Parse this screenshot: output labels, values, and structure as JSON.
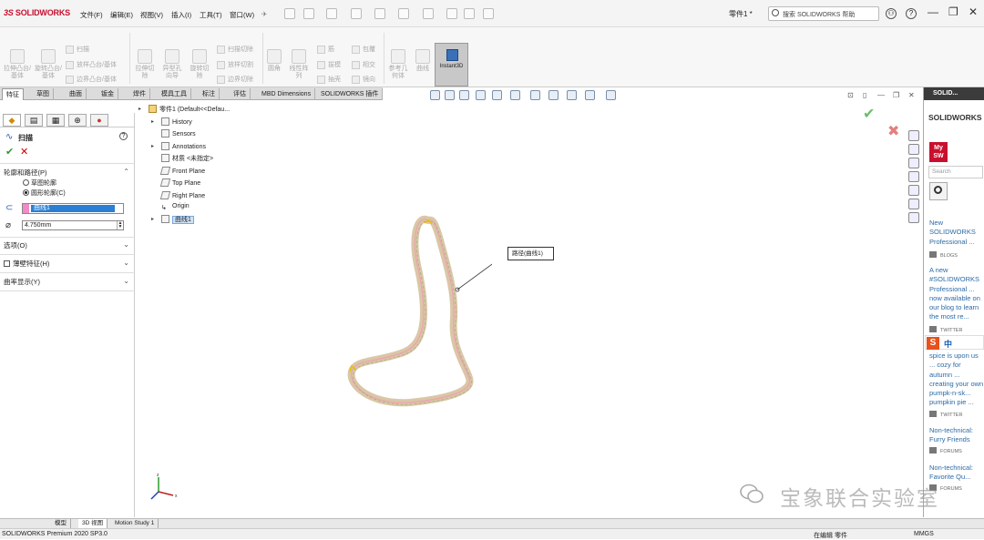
{
  "app": {
    "brand": "SOLIDWORKS",
    "doc_title": "零件1 *"
  },
  "menu": [
    "文件(F)",
    "编辑(E)",
    "视图(V)",
    "插入(I)",
    "工具(T)",
    "窗口(W)"
  ],
  "search": {
    "text": "搜索 SOLIDWORKS 帮助"
  },
  "window_controls": {
    "minimize": "—",
    "restore": "❐",
    "close": "✕"
  },
  "features": {
    "extrude_boss": "拉伸凸台/基体",
    "revolve_boss": "旋转凸台/基体",
    "sweep": "扫描",
    "loft_boss": "放样凸台/基体",
    "boundary_boss": "边界凸台/基体",
    "extrude_cut": "拉伸切除",
    "hole_wizard": "异型孔向导",
    "revolve_cut": "旋转切除",
    "swept_cut": "扫描切除",
    "lofted_cut": "放样切割",
    "boundary_cut": "边界切除",
    "fillet": "圆角",
    "linear_pattern": "线性阵列",
    "rib": "筋",
    "draft": "拔模",
    "shell": "抽壳",
    "wrap": "包覆",
    "intersect": "相交",
    "mirror": "镜向",
    "ref_geometry": "参考几何体",
    "curves": "曲线",
    "instant3d": "Instant3D"
  },
  "tabs": [
    "特征",
    "草图",
    "曲面",
    "钣金",
    "焊件",
    "模具工具",
    "标注",
    "评估",
    "MBD Dimensions",
    "SOLIDWORKS 插件"
  ],
  "property_manager": {
    "title": "扫描",
    "help": "?",
    "ok": "✔",
    "cancel": "✕",
    "profile_group": "轮廓和路径(P)",
    "radio_sketch": "草图轮廓",
    "radio_circular": "圆形轮廓(C)",
    "path_selection": "曲线1",
    "diameter": "4.750mm",
    "options": "选项(O)",
    "thin_feature": "薄壁特征(H)",
    "curvature_display": "曲率显示(Y)"
  },
  "tree": {
    "root": "零件1  (Default<<Defau...",
    "items": [
      "History",
      "Sensors",
      "Annotations",
      "材质 <未指定>",
      "Front Plane",
      "Top Plane",
      "Right Plane",
      "Origin",
      "曲线1"
    ]
  },
  "callout": "路径(曲线1)",
  "taskpane": {
    "header": "SOLID...",
    "brand": "SOLIDWORKS Forum",
    "mysw": "My SW",
    "search": "Search",
    "feeds": [
      {
        "text": "New SOLIDWORKS Professional ... Now Available",
        "tag": "BLOGS"
      },
      {
        "text": "A new #SOLIDWORKS Professional ... now available on our blog to learn the most re... https://t.co",
        "tag": "TWITTER"
      },
      {
        "text": "spice is upon us ... cozy for autumn ... creating your own pumpk-n-sk... pumpkin pie ... https://t.co",
        "tag": "TWITTER"
      },
      {
        "text": "Non-technical: Furry Friends",
        "tag": "FORUMS"
      },
      {
        "text": "Non-technical: Favorite Qu...",
        "tag": "FORUMS"
      }
    ]
  },
  "ime": "中",
  "bottom_tabs": [
    "模型",
    "3D 视图",
    "Motion Study 1"
  ],
  "status": {
    "left": "SOLIDWORKS Premium 2020 SP3.0",
    "editing": "在编辑 零件",
    "units": "MMGS"
  },
  "watermark": "宝象联合实验室",
  "colors": {
    "brand_red": "#c8102e",
    "selection_blue": "#2a7fd4",
    "ok_green": "#2e9a2e",
    "cancel_red": "#cc0000"
  }
}
